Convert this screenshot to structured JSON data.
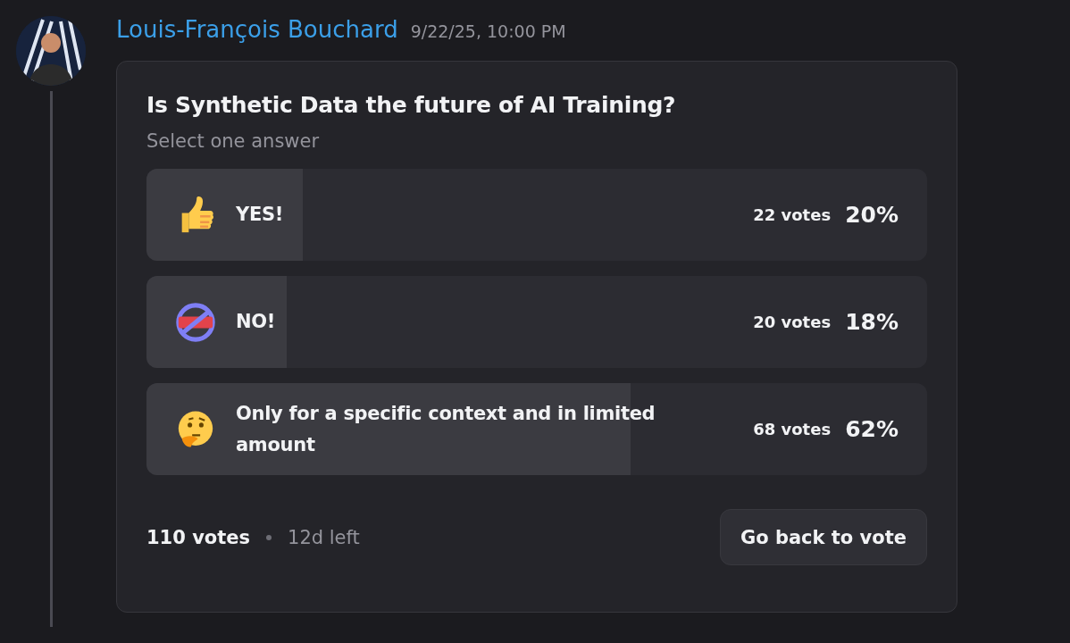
{
  "message": {
    "author": "Louis-François Bouchard",
    "timestamp": "9/22/25, 10:00 PM"
  },
  "poll": {
    "question": "Is Synthetic Data the future of AI Training?",
    "hint": "Select one answer",
    "answers": [
      {
        "label": "YES!",
        "votes": "22 votes",
        "percent": "20%",
        "level": 0.2
      },
      {
        "label": "NO!",
        "votes": "20 votes",
        "percent": "18%",
        "level": 0.18
      },
      {
        "label": "Only for a specific context and in limited amount",
        "votes": "68 votes",
        "percent": "62%",
        "level": 0.62
      }
    ],
    "total": "110 votes",
    "time_left": "12d left",
    "button": "Go back to vote"
  }
}
